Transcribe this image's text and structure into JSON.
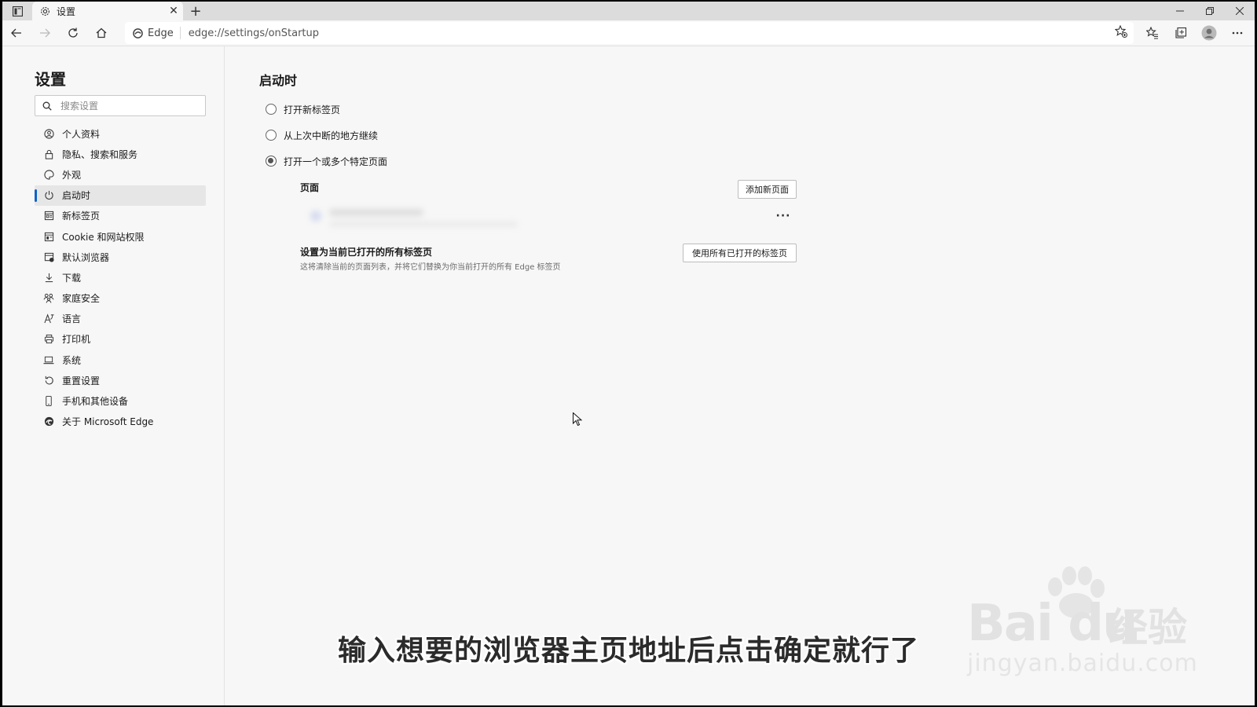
{
  "browser": {
    "tab_title": "设置",
    "tab_close": "✕",
    "new_tab": "+",
    "site_name": "Edge",
    "url": "edge://settings/onStartup"
  },
  "sidebar": {
    "title": "设置",
    "search_placeholder": "搜索设置",
    "items": [
      {
        "label": "个人资料",
        "icon": "profile-icon"
      },
      {
        "label": "隐私、搜索和服务",
        "icon": "lock-icon"
      },
      {
        "label": "外观",
        "icon": "appearance-icon"
      },
      {
        "label": "启动时",
        "icon": "power-icon"
      },
      {
        "label": "新标签页",
        "icon": "new-tab-icon"
      },
      {
        "label": "Cookie 和网站权限",
        "icon": "cookie-icon"
      },
      {
        "label": "默认浏览器",
        "icon": "default-browser-icon"
      },
      {
        "label": "下载",
        "icon": "download-icon"
      },
      {
        "label": "家庭安全",
        "icon": "family-icon"
      },
      {
        "label": "语言",
        "icon": "language-icon"
      },
      {
        "label": "打印机",
        "icon": "printer-icon"
      },
      {
        "label": "系统",
        "icon": "system-icon"
      },
      {
        "label": "重置设置",
        "icon": "reset-icon"
      },
      {
        "label": "手机和其他设备",
        "icon": "phone-icon"
      },
      {
        "label": "关于 Microsoft Edge",
        "icon": "edge-logo-icon"
      }
    ],
    "active_index": 3
  },
  "content": {
    "title": "启动时",
    "options": [
      {
        "label": "打开新标签页",
        "checked": false
      },
      {
        "label": "从上次中断的地方继续",
        "checked": false
      },
      {
        "label": "打开一个或多个特定页面",
        "checked": true
      }
    ],
    "pages_label": "页面",
    "add_page_button": "添加新页面",
    "more_button": "···",
    "set_current_title": "设置为当前已打开的所有标签页",
    "set_current_desc": "这将清除当前的页面列表，并将它们替换为你当前打开的所有 Edge 标签页",
    "use_all_button": "使用所有已打开的标签页"
  },
  "overlay": {
    "subtitle": "输入想要的浏览器主页地址后点击确定就行了",
    "watermark_brand": "Bai du",
    "watermark_cn": "经验",
    "watermark_url": "jingyan.baidu.com"
  },
  "colors": {
    "accent": "#0b62c6",
    "page_bg": "#f7f7f7",
    "titlebar_bg": "#dcdcdc"
  }
}
